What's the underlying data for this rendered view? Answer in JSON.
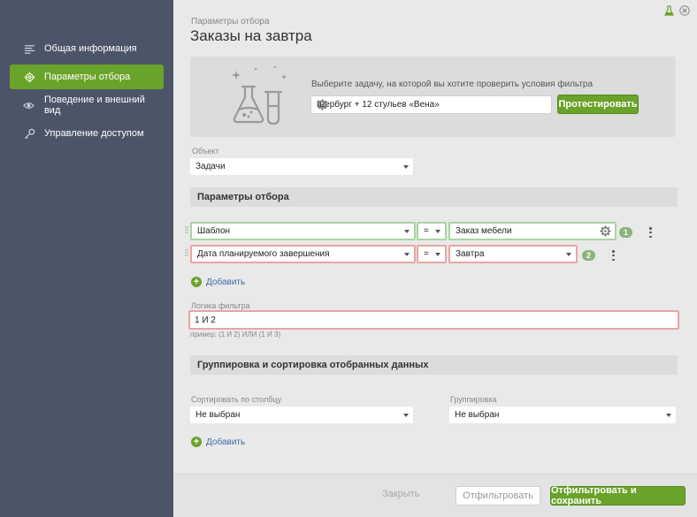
{
  "sidebar": {
    "items": [
      {
        "label": "Общая информация",
        "icon": "list-icon"
      },
      {
        "label": "Параметры отбора",
        "icon": "gear-icon",
        "active": true
      },
      {
        "label": "Поведение и внешний вид",
        "icon": "eye-icon"
      },
      {
        "label": "Управление доступом",
        "icon": "key-icon"
      }
    ]
  },
  "header": {
    "subtitle": "Параметры отбора",
    "title": "Заказы на завтра"
  },
  "test": {
    "hint": "Выберите задачу, на которой вы хотите проверить условия фильтра",
    "task_value": "Шербург + 12 стульев «Вена»",
    "button_label": "Протестировать"
  },
  "object": {
    "label": "Объект",
    "value": "Задачи"
  },
  "filter_section": {
    "title": "Параметры отбора",
    "conditions": [
      {
        "field": "Шаблон",
        "operator": "=",
        "value": "Заказ мебели",
        "number": "1"
      },
      {
        "field": "Дата планируемого завершения",
        "operator": "=",
        "value": "Завтра",
        "number": "2"
      }
    ],
    "add_label": "Добавить"
  },
  "logic": {
    "label": "Логика фильтра",
    "value": "1 И 2",
    "example": "пример: (1 И 2) ИЛИ (1 И 3)"
  },
  "grouping_section": {
    "title": "Группировка и сортировка отобранных данных",
    "sort_label": "Сортировать по столбцу",
    "sort_value": "Не выбран",
    "group_label": "Группировка",
    "group_value": "Не выбран",
    "add_label": "Добавить"
  },
  "footer": {
    "close_label": "Закрыть",
    "filter_label": "Отфильтровать",
    "filter_save_label": "Отфильтровать и сохранить"
  },
  "colors": {
    "sidebar_bg": "#4c5468",
    "accent_green": "#6aa32a",
    "valid_border": "#a9d4a0",
    "error_border": "#e7a5a5"
  }
}
